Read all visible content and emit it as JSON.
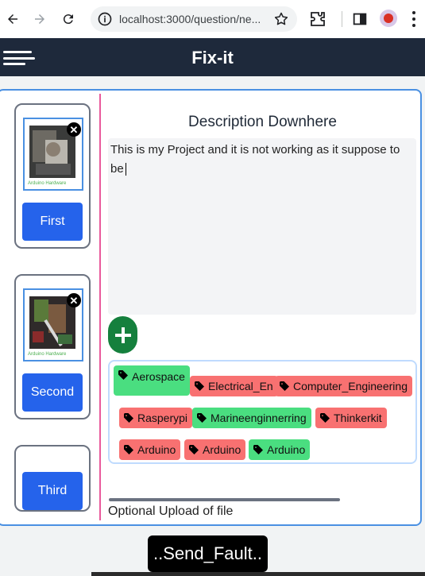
{
  "browser": {
    "url": "localhost:3000/question/ne...",
    "icons": [
      "back-arrow-icon",
      "forward-arrow-icon",
      "reload-icon",
      "site-info-icon",
      "bookmark-star-icon",
      "extensions-icon",
      "side-panel-icon",
      "profile-avatar",
      "more-menu-icon"
    ]
  },
  "header": {
    "title": "Fix-it",
    "background": "#1e293b"
  },
  "thumbnails": [
    {
      "button_label": "First",
      "image_caption": "Arduino Hardware",
      "has_image": true
    },
    {
      "button_label": "Second",
      "image_caption": "Arduino Hardware",
      "has_image": true
    },
    {
      "button_label": "Third",
      "has_image": false
    }
  ],
  "description": {
    "title": "Description Downhere",
    "value": "This is my Project and it is not working as it suppose to be"
  },
  "tags": [
    {
      "label": "Aerospace",
      "color": "green"
    },
    {
      "label": "Electrical_En",
      "color": "red"
    },
    {
      "label": "Computer_Engineering",
      "color": "red"
    },
    {
      "label": "Rasperypi",
      "color": "red"
    },
    {
      "label": "Marineenginnerring",
      "color": "green"
    },
    {
      "label": "Thinkerkit",
      "color": "red"
    },
    {
      "label": "Arduino",
      "color": "red"
    },
    {
      "label": "Arduino",
      "color": "red"
    },
    {
      "label": "Arduino",
      "color": "green"
    }
  ],
  "upload": {
    "label": "Optional Upload of file"
  },
  "send_button": {
    "label": "..Send_Fault.."
  },
  "colors": {
    "accent_blue": "#2563eb",
    "tag_green": "#4ade80",
    "tag_red": "#f87171",
    "add_green": "#15803d",
    "divider_pink": "#e95a9c"
  }
}
